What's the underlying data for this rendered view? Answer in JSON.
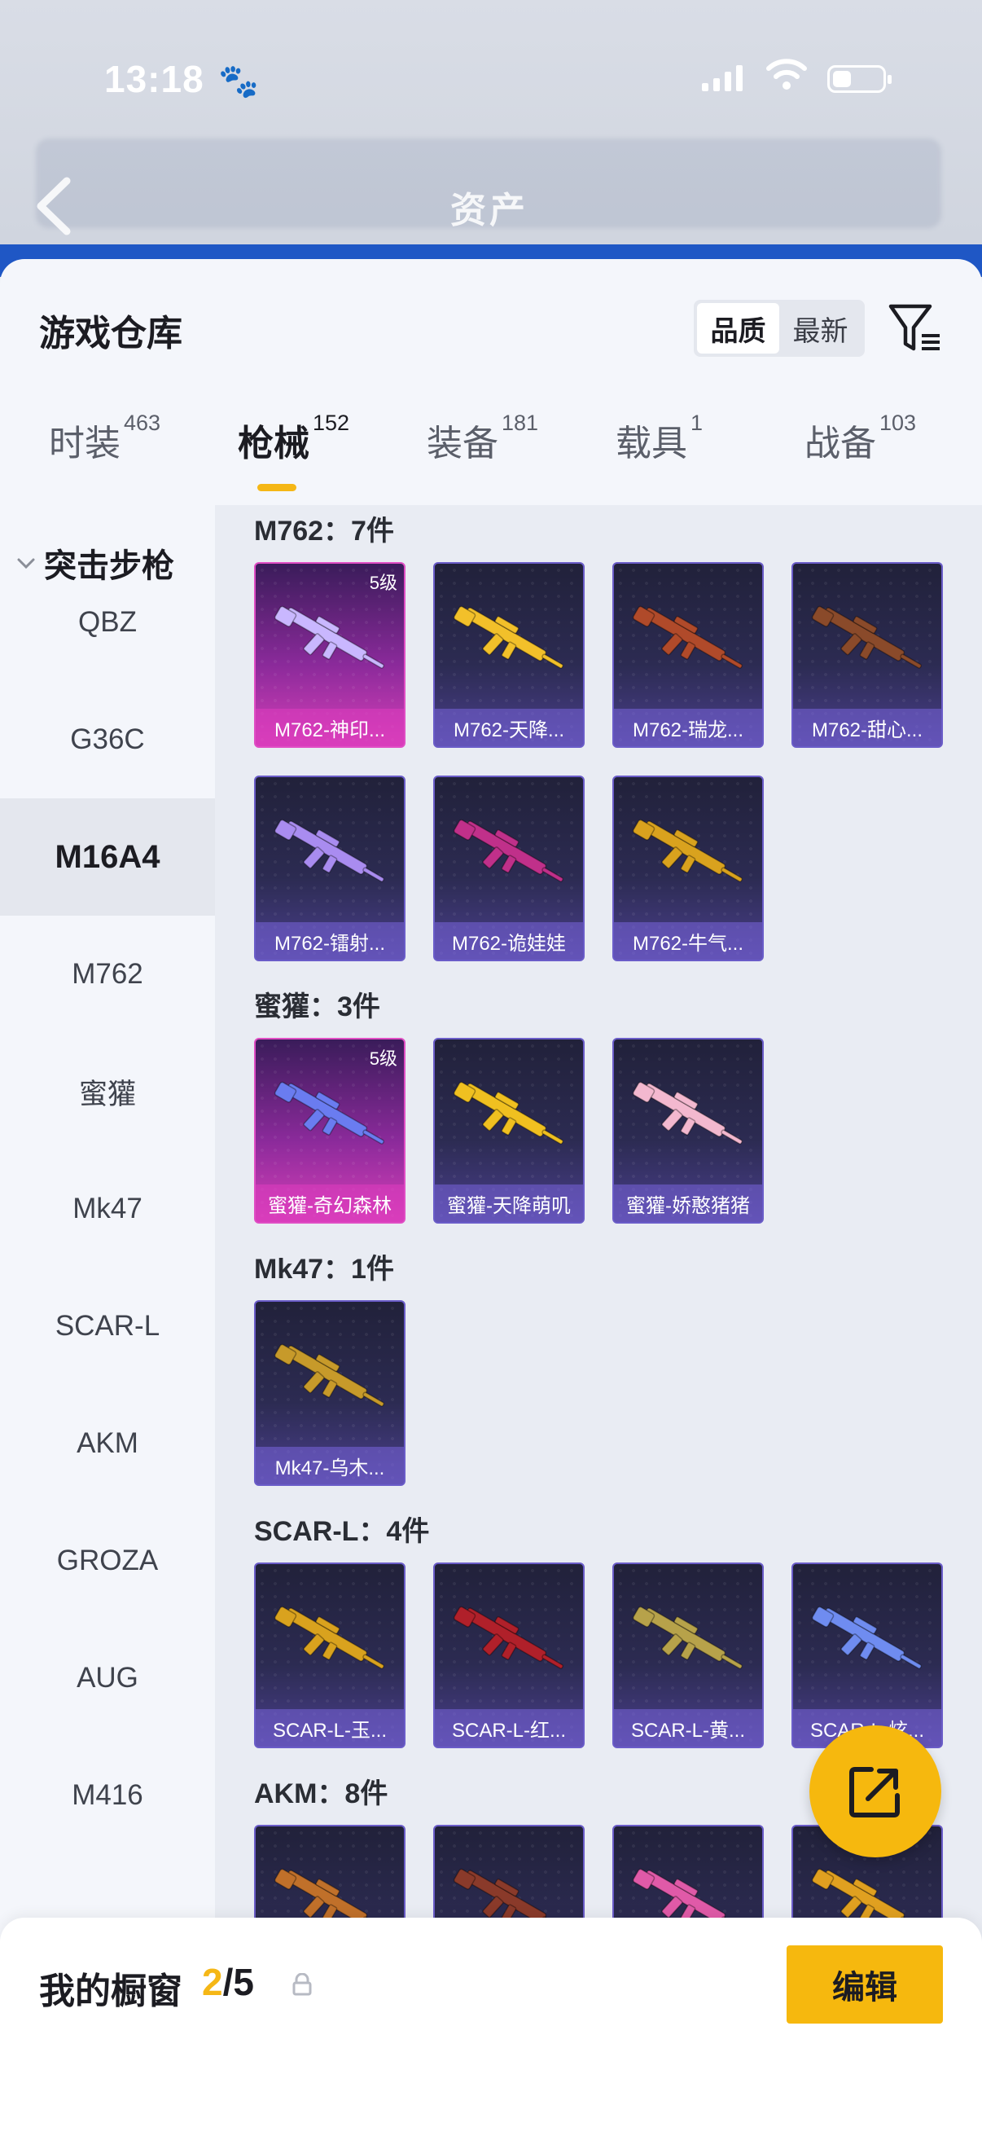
{
  "status_bar": {
    "time": "13:18",
    "paw_icon": "🐾"
  },
  "header": {
    "title": "资产"
  },
  "warehouse": {
    "title": "游戏仓库",
    "sort": {
      "quality": "品质",
      "newest": "最新"
    },
    "tabs": [
      {
        "label": "时装",
        "count": "463"
      },
      {
        "label": "枪械",
        "count": "152"
      },
      {
        "label": "装备",
        "count": "181"
      },
      {
        "label": "载具",
        "count": "1"
      },
      {
        "label": "战备",
        "count": "103"
      }
    ],
    "nav": {
      "group": "突击步枪",
      "items": [
        "QBZ",
        "G36C",
        "M16A4",
        "M762",
        "蜜獾",
        "Mk47",
        "SCAR-L",
        "AKM",
        "GROZA",
        "AUG",
        "M416"
      ],
      "selected": "M16A4"
    },
    "groups": [
      {
        "label": "M762：7件",
        "cards": [
          {
            "name": "M762-神印...",
            "level": "5级",
            "rarity": "pink",
            "gun_color": "#c9b7ff"
          },
          {
            "name": "M762-天降...",
            "rarity": "purple",
            "gun_color": "#f2c02a"
          },
          {
            "name": "M762-瑞龙...",
            "rarity": "purple",
            "gun_color": "#b04a2a"
          },
          {
            "name": "M762-甜心...",
            "rarity": "purple",
            "gun_color": "#8a4a2a"
          },
          {
            "name": "M762-镭射...",
            "rarity": "purple",
            "gun_color": "#a98cf0"
          },
          {
            "name": "M762-诡娃娃",
            "rarity": "purple",
            "gun_color": "#c0308a"
          },
          {
            "name": "M762-牛气...",
            "rarity": "purple",
            "gun_color": "#d9a21e"
          }
        ]
      },
      {
        "label": "蜜獾：3件",
        "cards": [
          {
            "name": "蜜獾-奇幻森林",
            "level": "5级",
            "rarity": "pink",
            "gun_color": "#6a7cf0"
          },
          {
            "name": "蜜獾-天降萌叽",
            "rarity": "purple",
            "gun_color": "#f0c020"
          },
          {
            "name": "蜜獾-娇憨猪猪",
            "rarity": "purple",
            "gun_color": "#f3b8cf"
          }
        ]
      },
      {
        "label": "Mk47：1件",
        "cards": [
          {
            "name": "Mk47-乌木...",
            "rarity": "purple",
            "gun_color": "#c79a2a"
          }
        ]
      },
      {
        "label": "SCAR-L：4件",
        "cards": [
          {
            "name": "SCAR-L-玉...",
            "rarity": "purple",
            "gun_color": "#d9a21e"
          },
          {
            "name": "SCAR-L-红...",
            "rarity": "purple",
            "gun_color": "#b0202a"
          },
          {
            "name": "SCAR-L-黄...",
            "rarity": "purple",
            "gun_color": "#b7a24a"
          },
          {
            "name": "SCAR-L-炫...",
            "rarity": "purple",
            "gun_color": "#6f8cf0"
          }
        ]
      },
      {
        "label": "AKM：8件",
        "cards": [
          {
            "name": "",
            "rarity": "purple",
            "gun_color": "#c0702a"
          },
          {
            "name": "",
            "rarity": "purple",
            "gun_color": "#8a3a2a"
          },
          {
            "name": "",
            "rarity": "purple",
            "gun_color": "#e05aa8"
          },
          {
            "name": "",
            "rarity": "purple",
            "gun_color": "#e0a020"
          }
        ]
      }
    ]
  },
  "showcase": {
    "label": "我的橱窗",
    "current": "2",
    "separator": "/",
    "max": "5",
    "edit_label": "编辑"
  },
  "colors": {
    "accent": "#f6b80e",
    "rare_purple": "#6a5cc8",
    "rare_pink": "#e04dc4"
  }
}
